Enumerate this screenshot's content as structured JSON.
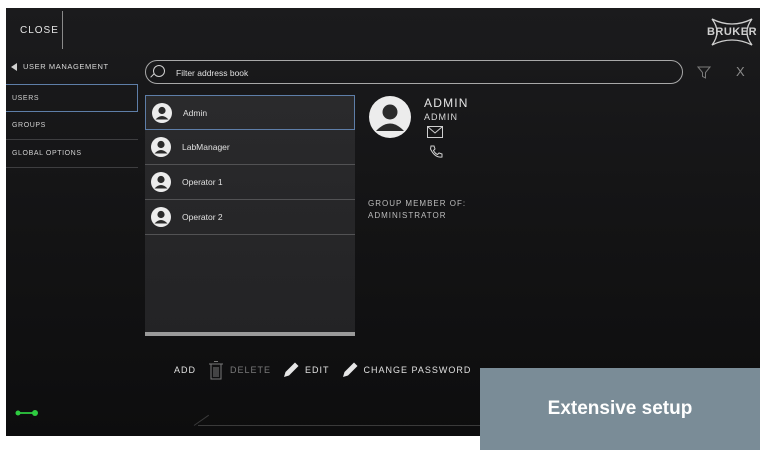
{
  "header": {
    "close_label": "CLOSE",
    "logo_text": "BRUKER"
  },
  "sidebar": {
    "back_label": "USER MANAGEMENT",
    "items": [
      {
        "label": "USERS",
        "active": true
      },
      {
        "label": "GROUPS",
        "active": false
      },
      {
        "label": "GLOBAL OPTIONS",
        "active": false
      }
    ]
  },
  "search": {
    "placeholder": "Filter address book",
    "value": ""
  },
  "icons": {
    "filter": "filter-icon",
    "clear": "X"
  },
  "users": [
    {
      "name": "Admin",
      "selected": true
    },
    {
      "name": "LabManager",
      "selected": false
    },
    {
      "name": "Operator 1",
      "selected": false
    },
    {
      "name": "Operator 2",
      "selected": false
    }
  ],
  "detail": {
    "name": "ADMIN",
    "role": "ADMIN",
    "group_label": "GROUP MEMBER OF:",
    "group_value": "ADMINISTRATOR"
  },
  "toolbar": {
    "add": "ADD",
    "delete": "DELETE",
    "edit": "EDIT",
    "change_password": "CHANGE PASSWORD"
  },
  "banner": {
    "text": "Extensive setup",
    "color": "#7a8c97"
  },
  "colors": {
    "accent_border": "#5e7ea8",
    "status_green": "#2ecc40"
  }
}
